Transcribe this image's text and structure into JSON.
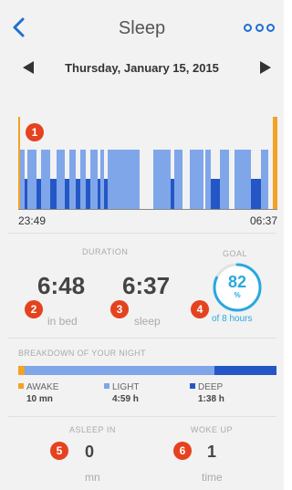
{
  "header": {
    "title": "Sleep"
  },
  "date_nav": {
    "date": "Thursday, January 15, 2015"
  },
  "colors": {
    "awake": "#f4a225",
    "light": "#80a6ea",
    "deep": "#2457c5",
    "accent": "#1f6fd0",
    "goal": "#29a8e0",
    "badge": "#e5421f"
  },
  "chart": {
    "start_time": "23:49",
    "end_time": "06:37",
    "segments": [
      {
        "stage": "awake",
        "start": 0.0,
        "end": 0.006
      },
      {
        "stage": "light",
        "start": 0.006,
        "end": 0.023
      },
      {
        "stage": "deep",
        "start": 0.023,
        "end": 0.035
      },
      {
        "stage": "light",
        "start": 0.035,
        "end": 0.072
      },
      {
        "stage": "deep",
        "start": 0.072,
        "end": 0.089
      },
      {
        "stage": "light",
        "start": 0.089,
        "end": 0.124
      },
      {
        "stage": "deep",
        "start": 0.124,
        "end": 0.149
      },
      {
        "stage": "light",
        "start": 0.149,
        "end": 0.18
      },
      {
        "stage": "deep",
        "start": 0.18,
        "end": 0.198
      },
      {
        "stage": "light",
        "start": 0.198,
        "end": 0.222
      },
      {
        "stage": "deep",
        "start": 0.222,
        "end": 0.241
      },
      {
        "stage": "light",
        "start": 0.241,
        "end": 0.262
      },
      {
        "stage": "deep",
        "start": 0.262,
        "end": 0.278
      },
      {
        "stage": "light",
        "start": 0.278,
        "end": 0.306
      },
      {
        "stage": "deep",
        "start": 0.306,
        "end": 0.317
      },
      {
        "stage": "light",
        "start": 0.317,
        "end": 0.33
      },
      {
        "stage": "deep",
        "start": 0.33,
        "end": 0.345
      },
      {
        "stage": "light",
        "start": 0.345,
        "end": 0.468
      },
      {
        "stage": "light",
        "start": 0.521,
        "end": 0.588
      },
      {
        "stage": "deep",
        "start": 0.588,
        "end": 0.602
      },
      {
        "stage": "light",
        "start": 0.602,
        "end": 0.634
      },
      {
        "stage": "light",
        "start": 0.662,
        "end": 0.715
      },
      {
        "stage": "light",
        "start": 0.722,
        "end": 0.743
      },
      {
        "stage": "deep",
        "start": 0.743,
        "end": 0.778
      },
      {
        "stage": "light",
        "start": 0.778,
        "end": 0.813
      },
      {
        "stage": "light",
        "start": 0.835,
        "end": 0.898
      },
      {
        "stage": "deep",
        "start": 0.898,
        "end": 0.937
      },
      {
        "stage": "light",
        "start": 0.937,
        "end": 0.965
      },
      {
        "stage": "awake",
        "start": 0.981,
        "end": 1.0
      }
    ]
  },
  "callouts": [
    "1",
    "2",
    "3",
    "4",
    "5",
    "6"
  ],
  "duration": {
    "caption": "DURATION",
    "in_bed": {
      "value": "6:48",
      "label": "in bed"
    },
    "sleep": {
      "value": "6:37",
      "label": "sleep"
    }
  },
  "goal": {
    "caption": "GOAL",
    "percent": "82",
    "percent_sign": "%",
    "percent_value": 82,
    "note": "of 8 hours"
  },
  "breakdown": {
    "title": "BREAKDOWN OF YOUR NIGHT",
    "fractions": {
      "awake": 0.024,
      "light": 0.735,
      "deep": 0.241
    },
    "items": [
      {
        "label": "AWAKE",
        "value": "10 mn",
        "color": "#f4a225"
      },
      {
        "label": "LIGHT",
        "value": "4:59 h",
        "color": "#80a6ea"
      },
      {
        "label": "DEEP",
        "value": "1:38 h",
        "color": "#2457c5"
      }
    ]
  },
  "asleep_in": {
    "caption": "ASLEEP IN",
    "value": "0",
    "unit": "mn"
  },
  "woke_up": {
    "caption": "WOKE UP",
    "value": "1",
    "unit": "time"
  }
}
